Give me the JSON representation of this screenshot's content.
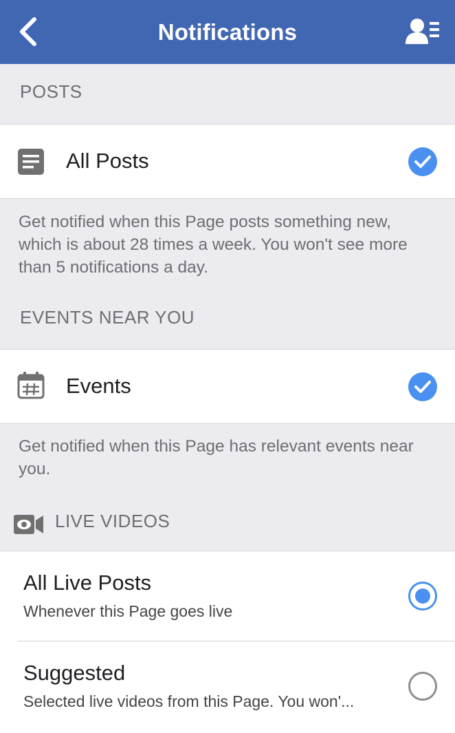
{
  "header": {
    "title": "Notifications"
  },
  "sections": {
    "posts": {
      "header": "POSTS",
      "row_label": "All Posts",
      "description": "Get notified when this Page posts something new, which is about 28 times a week. You won't see more than 5 notifications a day."
    },
    "events": {
      "header": "EVENTS NEAR YOU",
      "row_label": "Events",
      "description": "Get notified when this Page has relevant events near you."
    },
    "live": {
      "header": "LIVE VIDEOS",
      "options": [
        {
          "title": "All Live Posts",
          "subtitle": "Whenever this Page goes live",
          "selected": true
        },
        {
          "title": "Suggested",
          "subtitle": "Selected live videos from this Page. You won'...",
          "selected": false
        }
      ]
    }
  },
  "icons": {
    "back": "chevron-left-icon",
    "profile": "profile-list-icon",
    "posts": "document-icon",
    "events": "calendar-icon",
    "live": "video-camera-icon",
    "check": "checkmark-icon"
  },
  "colors": {
    "nav": "#4267b2",
    "accent": "#4a90f0",
    "background": "#ebebf0"
  }
}
